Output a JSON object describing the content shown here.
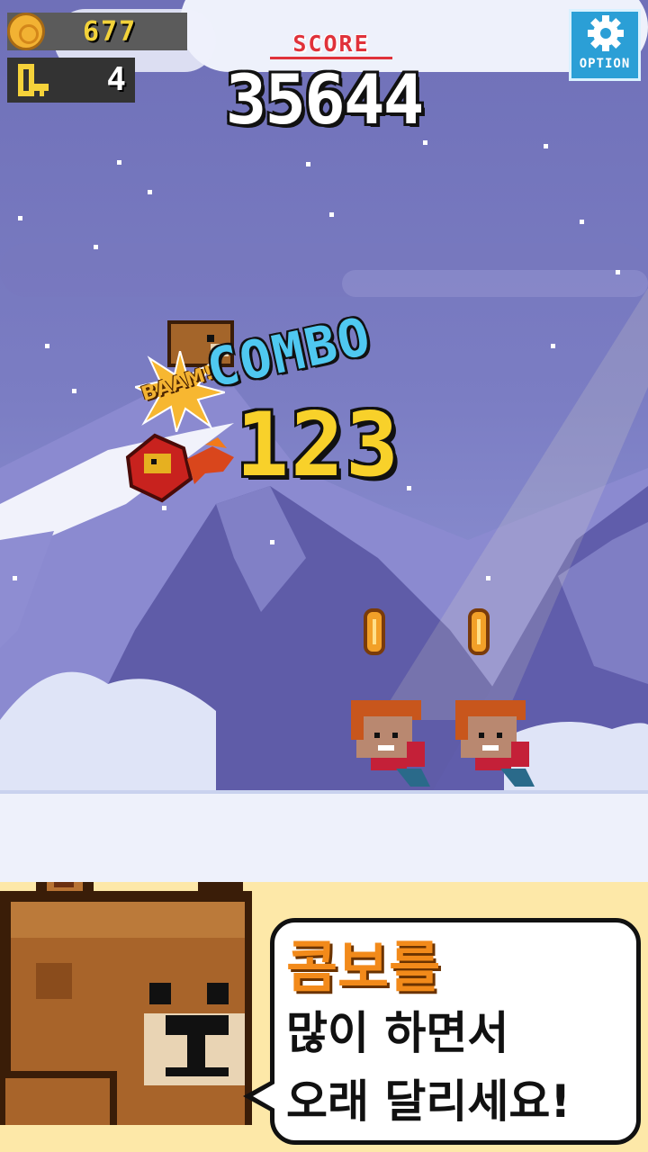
{
  "hud": {
    "coins": "677",
    "keys": "4",
    "score_label": "SCORE",
    "score": "35644",
    "option_label": "OPTION"
  },
  "combo": {
    "label": "COMBO",
    "count": "123",
    "hit_text": "BAAM!"
  },
  "tutorial": {
    "line1": "콤보를",
    "line2": "많이 하면서",
    "line3": "오래 달리세요!"
  },
  "colors": {
    "sky": "#7b7dc3",
    "mountain": "#5f5ca8",
    "snow": "#eef1fb",
    "score_label": "#e0323a",
    "combo_label": "#4fc8f0",
    "combo_count": "#f8d12a",
    "option_button": "#2b9fd6",
    "tutorial_bg": "#fde8a8",
    "tip_highlight": "#f28a1a"
  },
  "icons": {
    "coin": "coin-icon",
    "key": "key-icon",
    "option": "gear-icon"
  }
}
